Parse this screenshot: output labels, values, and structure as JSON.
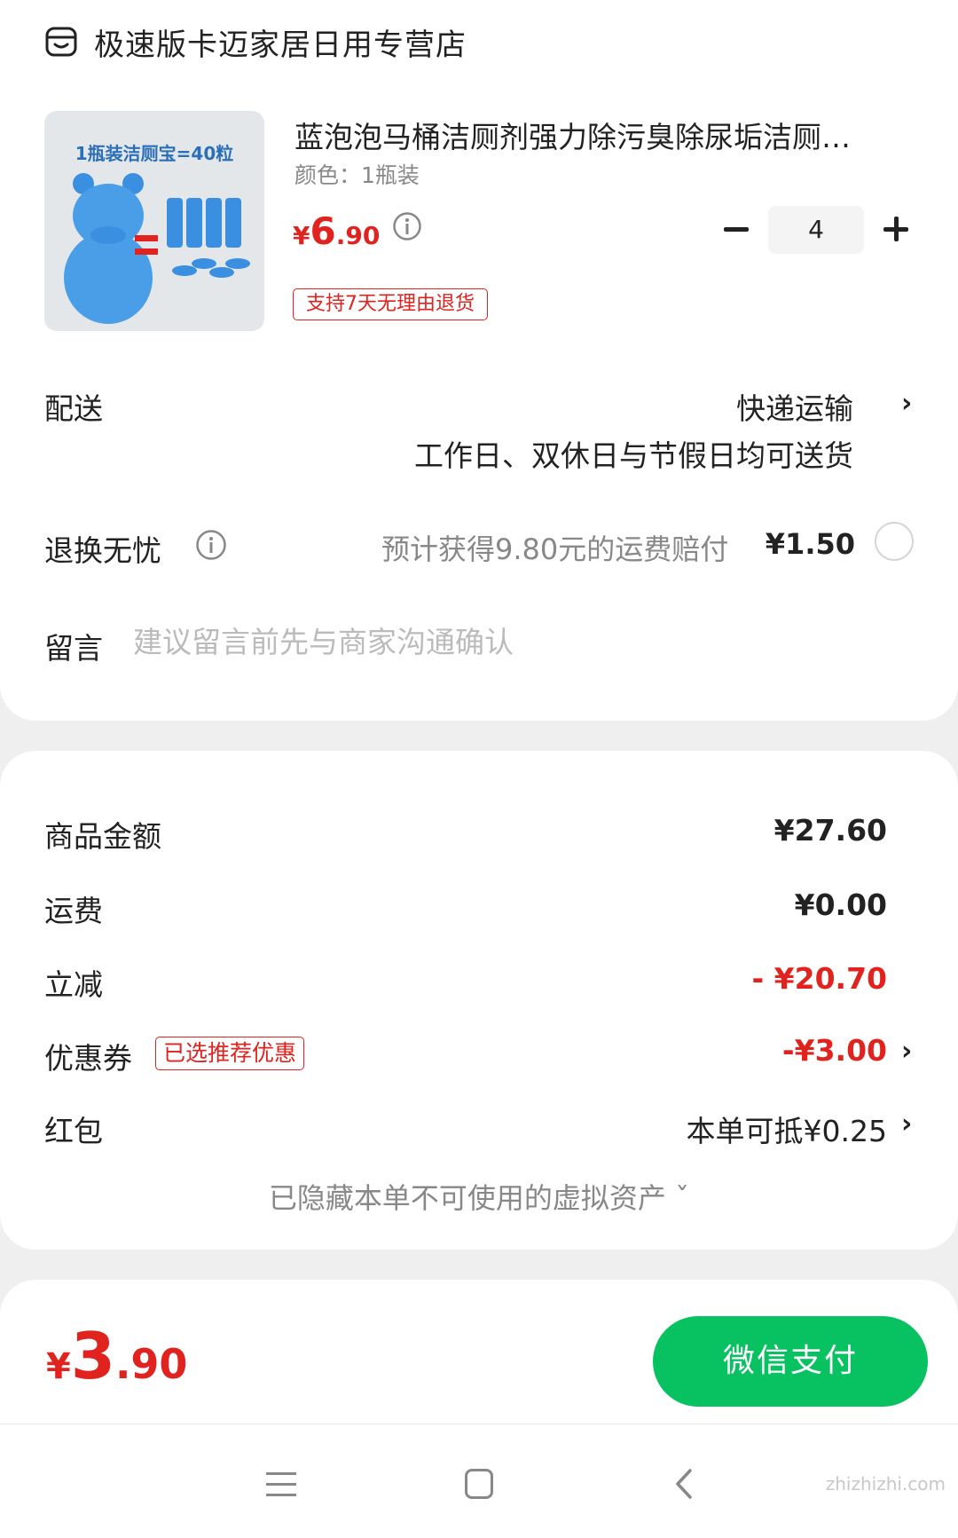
{
  "shop": {
    "name": "极速版卡迈家居日用专营店",
    "icon": "shop-icon"
  },
  "product": {
    "image_caption": "1瓶装洁厕宝=40粒",
    "title": "蓝泡泡马桶洁厕剂强力除污臭除尿垢洁厕…",
    "variant": "颜色：1瓶装",
    "price": {
      "currency": "¥",
      "integer": "6",
      "decimal": ".90"
    },
    "quantity": "4",
    "return_tag": "支持7天无理由退货"
  },
  "delivery": {
    "label": "配送",
    "method": "快递运输",
    "note": "工作日、双休日与节假日均可送货"
  },
  "return_service": {
    "label": "退换无忧",
    "description": "预计获得9.80元的运费赔付",
    "price": "¥1.50",
    "selected": false
  },
  "memo": {
    "label": "留言",
    "placeholder": "建议留言前先与商家沟通确认"
  },
  "summary": {
    "goods_label": "商品金额",
    "goods_value": "¥27.60",
    "shipping_label": "运费",
    "shipping_value": "¥0.00",
    "discount_label": "立减",
    "discount_value": "- ¥20.70",
    "coupon_label": "优惠券",
    "coupon_tag": "已选推荐优惠",
    "coupon_value": "-¥3.00",
    "redpacket_label": "红包",
    "redpacket_value": "本单可抵¥0.25",
    "hidden_assets": "已隐藏本单不可使用的虚拟资产 ˇ"
  },
  "checkout": {
    "total": {
      "currency": "¥",
      "integer": "3",
      "decimal": ".90"
    },
    "pay_label": "微信支付"
  },
  "watermark": "zhizhizhi.com",
  "colors": {
    "accent_red": "#e0231f",
    "pay_green": "#08c160",
    "muted": "#888888"
  }
}
